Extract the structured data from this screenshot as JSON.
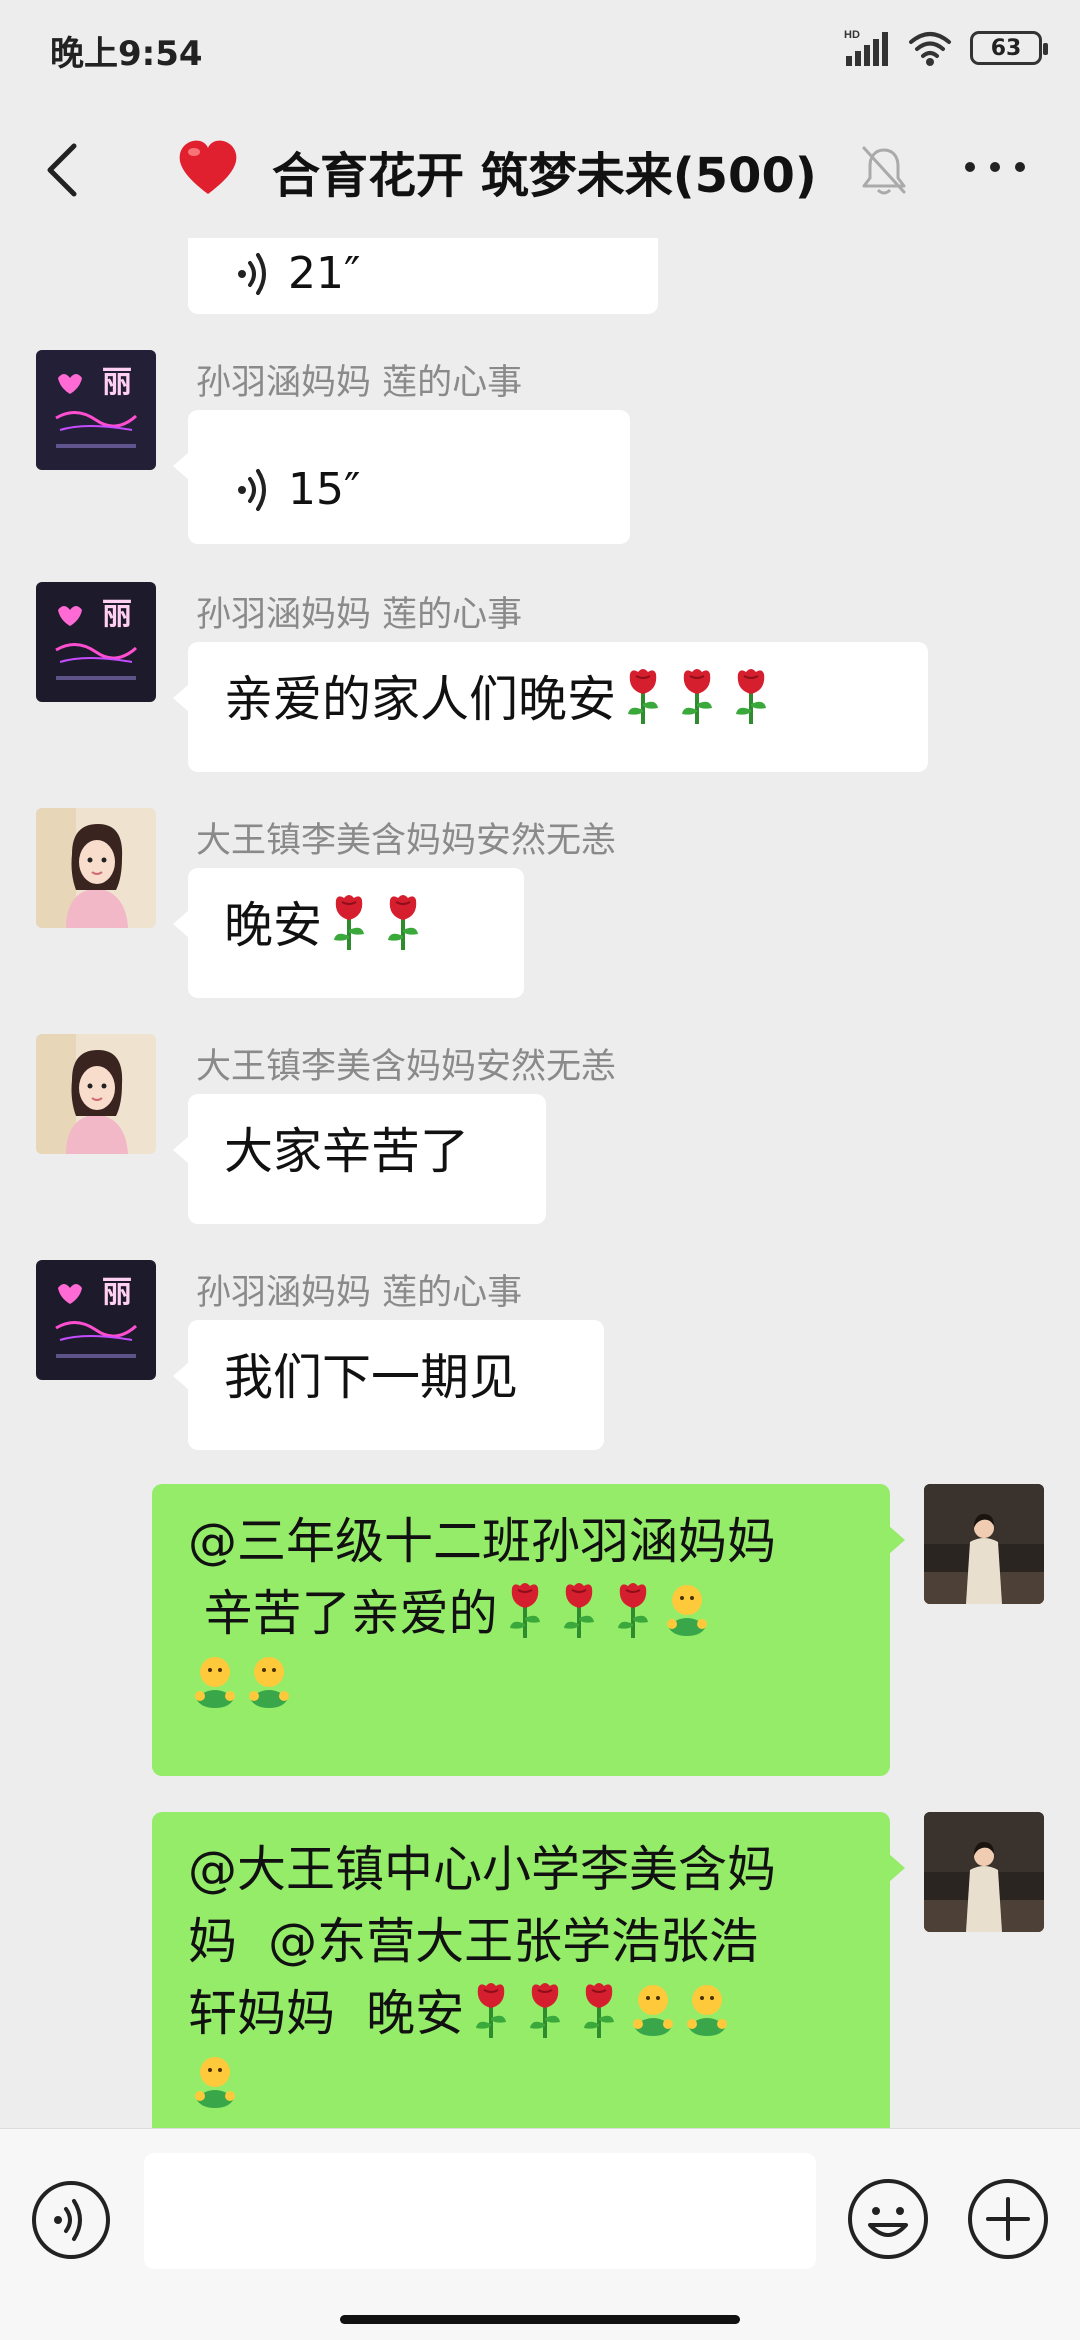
{
  "status_bar": {
    "time": "晚上9:54",
    "network": "HD",
    "battery": "63"
  },
  "header": {
    "title": "合育花开 筑梦未来(500)"
  },
  "messages": [
    {
      "voice_length": "21″"
    },
    {
      "sender": "孙羽涵妈妈  莲的心事",
      "voice_length": "15″"
    },
    {
      "sender": "孙羽涵妈妈  莲的心事",
      "text": "亲爱的家人们晚安"
    },
    {
      "sender": "大王镇李美含妈妈安然无恙",
      "text": "晚安"
    },
    {
      "sender": "大王镇李美含妈妈安然无恙",
      "text": "大家辛苦了"
    },
    {
      "sender": "孙羽涵妈妈  莲的心事",
      "text": "我们下一期见"
    },
    {
      "line1": "@三年级十二班孙羽涵妈妈",
      "line2": " 辛苦了亲爱的"
    },
    {
      "line1": "@大王镇中心小学李美含妈",
      "line2": "妈  @东营大王张学浩张浩",
      "line3": "轩妈妈  晚安"
    }
  ],
  "input": {
    "placeholder": ""
  },
  "colors": {
    "background": "#ededed",
    "bubble_in": "#ffffff",
    "bubble_out": "#95ec69",
    "sender_name": "#8a8a8a"
  }
}
